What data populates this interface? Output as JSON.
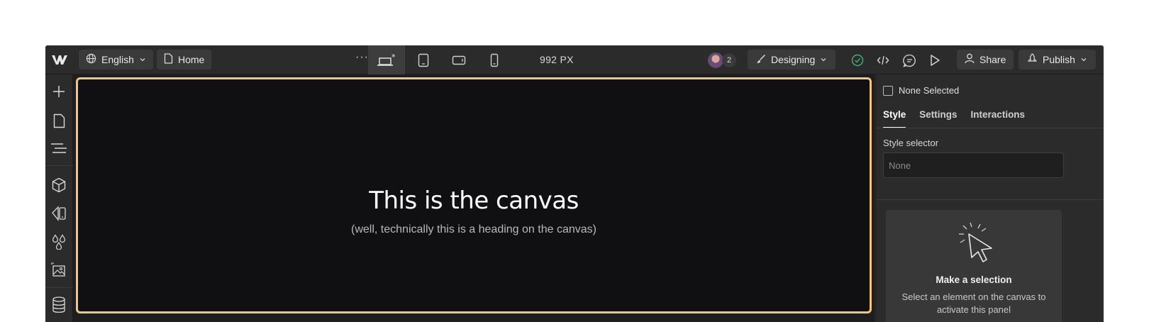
{
  "topbar": {
    "locale_label": "English",
    "page_label": "Home",
    "more_label": "···",
    "breakpoint_width": "992 PX",
    "collaborator_count": "2",
    "mode_label": "Designing",
    "share_label": "Share",
    "publish_label": "Publish"
  },
  "canvas": {
    "heading": "This is the canvas",
    "subheading": "(well, technically this is a heading on the canvas)"
  },
  "right_panel": {
    "selection_label": "None Selected",
    "tabs": [
      "Style",
      "Settings",
      "Interactions"
    ],
    "style_selector_label": "Style selector",
    "style_selector_placeholder": "None",
    "empty_title": "Make a selection",
    "empty_desc": "Select an element on the canvas to activate this panel"
  },
  "colors": {
    "canvas_outline": "#f5c67a",
    "app_bg": "#2b2b2b",
    "canvas_bg": "#101012"
  }
}
